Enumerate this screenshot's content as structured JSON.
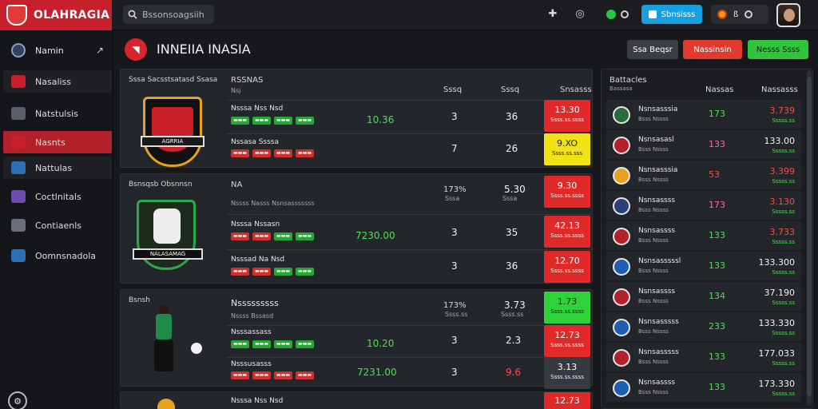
{
  "topbar": {
    "brand": "OLAHRAGIA",
    "search_placeholder": "Bssonsoagsiih",
    "blue_button": "Sbnsisss",
    "account_num": "ß"
  },
  "sidebar": {
    "header": "Namin",
    "items": [
      {
        "label": "Nasaliss",
        "icon": "dice-icon",
        "color": "#c8202a"
      },
      {
        "label": "Natstulsis",
        "icon": "cards-icon",
        "color": "#5a5f68"
      },
      {
        "label": "Nasnts",
        "icon": "flag-icon",
        "color": "#c8202a"
      },
      {
        "label": "Nattulas",
        "icon": "globe-icon",
        "color": "#2e6fb3"
      },
      {
        "label": "Coctlnitals",
        "icon": "chart-icon",
        "color": "#6c4cb0"
      },
      {
        "label": "Contiaenls",
        "icon": "grid-icon",
        "color": "#6b7078"
      },
      {
        "label": "Oomnsnadola",
        "icon": "bell-icon",
        "color": "#2e6fb3"
      }
    ]
  },
  "header": {
    "title": "INNEIIA INASIA",
    "btn_dark": "Ssa Beqsr",
    "btn_red": "Nassinsin",
    "btn_green": "Nesss Ssss"
  },
  "panels": [
    {
      "crest_title": "Sssa Sacsstsatasd Ssasa",
      "crest_text": "AGRRIA",
      "col_headers": [
        "RSSNAS",
        "Sssq",
        "Sssq",
        "Snsasss"
      ],
      "head_sub": "Nsj",
      "rows": [
        {
          "label": "Nsssa Nss Nsd",
          "pills": [
            "g",
            "g",
            "g",
            "g"
          ],
          "green": "10.36",
          "a": "3",
          "b": "36",
          "odd": "13.30",
          "odd_sub": "Ssss.ss.ssss",
          "odd_color": "red"
        },
        {
          "label": "Nssasa Ssssa",
          "pills": [
            "r",
            "r",
            "r",
            "r"
          ],
          "green": "",
          "a": "7",
          "b": "26",
          "odd": "9.XO",
          "odd_sub": "Ssss.ss.sss",
          "odd_color": "yel"
        }
      ]
    },
    {
      "crest_title": "Bsnsqsb Obsnnsn",
      "crest_text": "NALASAMAG",
      "col_headers": [
        "NA",
        "",
        "173%",
        "5.30"
      ],
      "head_sub": "Nssss Nasss Nsnsasssssss",
      "head_sub2": "Sssa",
      "rows": [
        {
          "label": "Nsssa Nssasn",
          "pills": [
            "r",
            "r",
            "g",
            "g"
          ],
          "green": "7230.00",
          "a": "3",
          "b": "35",
          "odd": "42.13",
          "odd_sub": "Ssss.ss.ssss",
          "odd_color": "red"
        },
        {
          "label": "Nsssad Na Nsd",
          "pills": [
            "r",
            "r",
            "g",
            "g"
          ],
          "green": "",
          "a": "3",
          "b": "36",
          "odd": "12.70",
          "odd_sub": "Ssss.ss.ssss",
          "odd_color": "red"
        }
      ]
    },
    {
      "crest_title": "Bsnsh",
      "col_headers": [
        "Nsssssssss",
        "",
        "173%",
        "3.73"
      ],
      "head_sub": "Nssss Bssasd",
      "head_sub2": "Ssss.ss",
      "rows": [
        {
          "label": "Nsssassass",
          "pills": [
            "g",
            "g",
            "g",
            "g"
          ],
          "green": "10.20",
          "a": "3",
          "b": "2.3",
          "odd": "12.73",
          "odd_sub": "Ssss.ss.ssss",
          "odd_color": "red"
        },
        {
          "label": "Nsssusasss",
          "pills": [
            "r",
            "r",
            "r",
            "r"
          ],
          "green": "7231.00",
          "a": "3",
          "b": "9.6",
          "odd": "3.13",
          "odd_sub": "Ssss.ss.ssss",
          "odd_color": "gray",
          "b_red": true
        }
      ]
    },
    {
      "rows": [
        {
          "label": "Nsssa Nss Nsd",
          "odd": "12.73",
          "odd_color": "red"
        }
      ]
    }
  ],
  "right": {
    "headers": [
      "Battacles",
      "Nassas",
      "Nassasss"
    ],
    "head_sub": "Bassasa",
    "items": [
      {
        "name": "Nsnsasssia",
        "sub": "Bsss Nssss",
        "count": "173",
        "count_color": "#4ae24e",
        "value": "3.739",
        "value_color": "#ff4a3a",
        "sub2": "Sssss.ss"
      },
      {
        "name": "Nsnsasasl",
        "sub": "Bsss Nssss",
        "count": "133",
        "count_color": "#ff6a9a",
        "value": "133.00",
        "value_color": "#f2f2f2",
        "sub2": "Sssss.ss"
      },
      {
        "name": "Nsnsasssia",
        "sub": "Bsss Nssss",
        "count": "53",
        "count_color": "#ff4a3a",
        "value": "3.399",
        "value_color": "#ff4a3a",
        "sub2": "Sssss.ss"
      },
      {
        "name": "Nsnsassss",
        "sub": "Bsss Nssss",
        "count": "173",
        "count_color": "#ff6a9a",
        "value": "3.130",
        "value_color": "#ff4a3a",
        "sub2": "Sssss.ss"
      },
      {
        "name": "Nsnsassss",
        "sub": "Bsss Nssss",
        "count": "133",
        "count_color": "#4ae24e",
        "value": "3.733",
        "value_color": "#ff4a3a",
        "sub2": "Sssss.ss"
      },
      {
        "name": "Nsnsasssssl",
        "sub": "Bsss Nssss",
        "count": "133",
        "count_color": "#4ae24e",
        "value": "133.300",
        "value_color": "#f2f2f2",
        "sub2": "Sssss.ss"
      },
      {
        "name": "Nsnsassss",
        "sub": "Bsss Nssss",
        "count": "134",
        "count_color": "#4ae24e",
        "value": "37.190",
        "value_color": "#f2f2f2",
        "sub2": "Sssss.ss"
      },
      {
        "name": "Nsnsasssss",
        "sub": "Bsss Nssss",
        "count": "233",
        "count_color": "#4ae24e",
        "value": "133.330",
        "value_color": "#f2f2f2",
        "sub2": "Sssss.ss"
      },
      {
        "name": "Nsnsasssss",
        "sub": "Bsss Nssss",
        "count": "133",
        "count_color": "#4ae24e",
        "value": "177.033",
        "value_color": "#f2f2f2",
        "sub2": "Sssss.ss"
      },
      {
        "name": "Nsnsassss",
        "sub": "Bsss Nssss",
        "count": "133",
        "count_color": "#4ae24e",
        "value": "173.330",
        "value_color": "#f2f2f2",
        "sub2": "Sssss.ss"
      }
    ]
  }
}
